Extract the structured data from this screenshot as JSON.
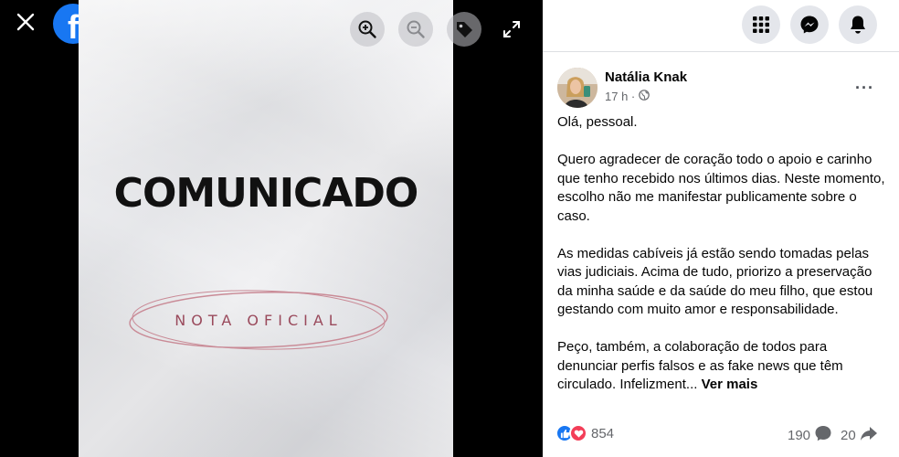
{
  "viewer": {
    "headline": "COMUNICADO",
    "subheadline": "NOTA OFICIAL",
    "icons": [
      "close-icon",
      "facebook-logo",
      "zoom-in-icon",
      "zoom-out-icon",
      "tag-icon",
      "fullscreen-icon"
    ]
  },
  "topbar": {
    "icons": [
      "menu-grid-icon",
      "messenger-icon",
      "notifications-bell-icon"
    ]
  },
  "post": {
    "author": "Natália Knak",
    "time": "17 h ·",
    "paragraphs": [
      "Olá, pessoal.",
      "Quero agradecer de coração todo o apoio e carinho que tenho recebido nos últimos dias. Neste momento, escolho não me manifestar publicamente sobre o caso.",
      "As medidas cabíveis já estão sendo tomadas pelas vias judiciais. Acima de tudo, priorizo a preservação da minha saúde e da saúde do meu filho, que estou gestando com muito amor e responsabilidade.",
      "Peço, também, a colaboração de todos para denunciar perfis falsos e as fake news que têm circulado. Infelizment..."
    ],
    "see_more": "Ver mais",
    "reactions_count": "854",
    "comments_count": "190",
    "shares_count": "20"
  },
  "colors": {
    "facebook_blue": "#1877f2",
    "like_blue": "#1877f2",
    "love_red": "#f33e58",
    "nota_rose": "#9a4a5c"
  }
}
